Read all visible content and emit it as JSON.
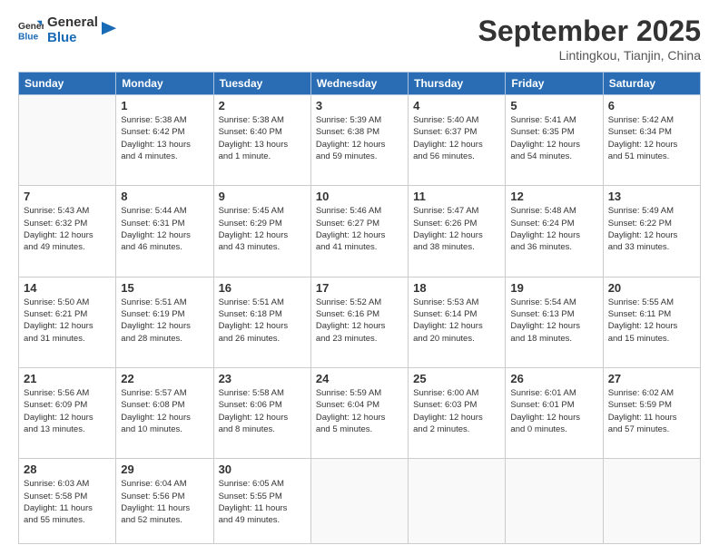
{
  "header": {
    "logo_general": "General",
    "logo_blue": "Blue",
    "title": "September 2025",
    "subtitle": "Lintingkou, Tianjin, China"
  },
  "weekdays": [
    "Sunday",
    "Monday",
    "Tuesday",
    "Wednesday",
    "Thursday",
    "Friday",
    "Saturday"
  ],
  "weeks": [
    [
      {
        "day": "",
        "info": ""
      },
      {
        "day": "1",
        "info": "Sunrise: 5:38 AM\nSunset: 6:42 PM\nDaylight: 13 hours\nand 4 minutes."
      },
      {
        "day": "2",
        "info": "Sunrise: 5:38 AM\nSunset: 6:40 PM\nDaylight: 13 hours\nand 1 minute."
      },
      {
        "day": "3",
        "info": "Sunrise: 5:39 AM\nSunset: 6:38 PM\nDaylight: 12 hours\nand 59 minutes."
      },
      {
        "day": "4",
        "info": "Sunrise: 5:40 AM\nSunset: 6:37 PM\nDaylight: 12 hours\nand 56 minutes."
      },
      {
        "day": "5",
        "info": "Sunrise: 5:41 AM\nSunset: 6:35 PM\nDaylight: 12 hours\nand 54 minutes."
      },
      {
        "day": "6",
        "info": "Sunrise: 5:42 AM\nSunset: 6:34 PM\nDaylight: 12 hours\nand 51 minutes."
      }
    ],
    [
      {
        "day": "7",
        "info": "Sunrise: 5:43 AM\nSunset: 6:32 PM\nDaylight: 12 hours\nand 49 minutes."
      },
      {
        "day": "8",
        "info": "Sunrise: 5:44 AM\nSunset: 6:31 PM\nDaylight: 12 hours\nand 46 minutes."
      },
      {
        "day": "9",
        "info": "Sunrise: 5:45 AM\nSunset: 6:29 PM\nDaylight: 12 hours\nand 43 minutes."
      },
      {
        "day": "10",
        "info": "Sunrise: 5:46 AM\nSunset: 6:27 PM\nDaylight: 12 hours\nand 41 minutes."
      },
      {
        "day": "11",
        "info": "Sunrise: 5:47 AM\nSunset: 6:26 PM\nDaylight: 12 hours\nand 38 minutes."
      },
      {
        "day": "12",
        "info": "Sunrise: 5:48 AM\nSunset: 6:24 PM\nDaylight: 12 hours\nand 36 minutes."
      },
      {
        "day": "13",
        "info": "Sunrise: 5:49 AM\nSunset: 6:22 PM\nDaylight: 12 hours\nand 33 minutes."
      }
    ],
    [
      {
        "day": "14",
        "info": "Sunrise: 5:50 AM\nSunset: 6:21 PM\nDaylight: 12 hours\nand 31 minutes."
      },
      {
        "day": "15",
        "info": "Sunrise: 5:51 AM\nSunset: 6:19 PM\nDaylight: 12 hours\nand 28 minutes."
      },
      {
        "day": "16",
        "info": "Sunrise: 5:51 AM\nSunset: 6:18 PM\nDaylight: 12 hours\nand 26 minutes."
      },
      {
        "day": "17",
        "info": "Sunrise: 5:52 AM\nSunset: 6:16 PM\nDaylight: 12 hours\nand 23 minutes."
      },
      {
        "day": "18",
        "info": "Sunrise: 5:53 AM\nSunset: 6:14 PM\nDaylight: 12 hours\nand 20 minutes."
      },
      {
        "day": "19",
        "info": "Sunrise: 5:54 AM\nSunset: 6:13 PM\nDaylight: 12 hours\nand 18 minutes."
      },
      {
        "day": "20",
        "info": "Sunrise: 5:55 AM\nSunset: 6:11 PM\nDaylight: 12 hours\nand 15 minutes."
      }
    ],
    [
      {
        "day": "21",
        "info": "Sunrise: 5:56 AM\nSunset: 6:09 PM\nDaylight: 12 hours\nand 13 minutes."
      },
      {
        "day": "22",
        "info": "Sunrise: 5:57 AM\nSunset: 6:08 PM\nDaylight: 12 hours\nand 10 minutes."
      },
      {
        "day": "23",
        "info": "Sunrise: 5:58 AM\nSunset: 6:06 PM\nDaylight: 12 hours\nand 8 minutes."
      },
      {
        "day": "24",
        "info": "Sunrise: 5:59 AM\nSunset: 6:04 PM\nDaylight: 12 hours\nand 5 minutes."
      },
      {
        "day": "25",
        "info": "Sunrise: 6:00 AM\nSunset: 6:03 PM\nDaylight: 12 hours\nand 2 minutes."
      },
      {
        "day": "26",
        "info": "Sunrise: 6:01 AM\nSunset: 6:01 PM\nDaylight: 12 hours\nand 0 minutes."
      },
      {
        "day": "27",
        "info": "Sunrise: 6:02 AM\nSunset: 5:59 PM\nDaylight: 11 hours\nand 57 minutes."
      }
    ],
    [
      {
        "day": "28",
        "info": "Sunrise: 6:03 AM\nSunset: 5:58 PM\nDaylight: 11 hours\nand 55 minutes."
      },
      {
        "day": "29",
        "info": "Sunrise: 6:04 AM\nSunset: 5:56 PM\nDaylight: 11 hours\nand 52 minutes."
      },
      {
        "day": "30",
        "info": "Sunrise: 6:05 AM\nSunset: 5:55 PM\nDaylight: 11 hours\nand 49 minutes."
      },
      {
        "day": "",
        "info": ""
      },
      {
        "day": "",
        "info": ""
      },
      {
        "day": "",
        "info": ""
      },
      {
        "day": "",
        "info": ""
      }
    ]
  ]
}
